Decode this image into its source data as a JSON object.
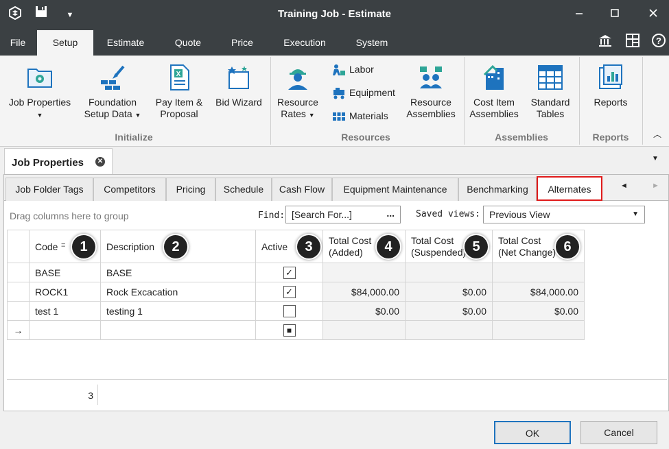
{
  "window": {
    "title": "Training Job - Estimate"
  },
  "menu": [
    "File",
    "Setup",
    "Estimate",
    "Quote",
    "Price",
    "Execution",
    "System"
  ],
  "ribbon": {
    "initialize": {
      "label": "Initialize",
      "job_properties": "Job Properties",
      "foundation_1": "Foundation",
      "foundation_2": "Setup Data",
      "pay_item_1": "Pay Item &",
      "pay_item_2": "Proposal",
      "bid_wizard": "Bid Wizard"
    },
    "resources": {
      "label": "Resources",
      "rates_1": "Resource",
      "rates_2": "Rates",
      "labor": "Labor",
      "equipment": "Equipment",
      "materials": "Materials",
      "assemblies_1": "Resource",
      "assemblies_2": "Assemblies"
    },
    "assemblies": {
      "label": "Assemblies",
      "cost_item_1": "Cost Item",
      "cost_item_2": "Assemblies",
      "standard_1": "Standard",
      "standard_2": "Tables"
    },
    "reports": {
      "label": "Reports",
      "reports": "Reports"
    }
  },
  "doc_tab": "Job Properties",
  "sub_tabs": [
    "Job Folder Tags",
    "Competitors",
    "Pricing",
    "Schedule",
    "Cash Flow",
    "Equipment Maintenance",
    "Benchmarking",
    "Alternates"
  ],
  "toolbar": {
    "group_hint": "Drag columns here to group",
    "find_label": "Find:",
    "find_placeholder": "[Search For...]",
    "find_more": "...",
    "saved_views_label": "Saved views:",
    "saved_view_value": "Previous View"
  },
  "columns": {
    "code": "Code",
    "description": "Description",
    "active": "Active",
    "added_1": "Total Cost",
    "added_2": "(Added)",
    "suspended_1": "Total Cost",
    "suspended_2": "(Suspended)",
    "net_1": "Total Cost",
    "net_2": "(Net Change)"
  },
  "callouts": [
    "1",
    "2",
    "3",
    "4",
    "5",
    "6"
  ],
  "rows": [
    {
      "code": "BASE",
      "description": "BASE",
      "active": true,
      "added": "",
      "suspended": "",
      "net": ""
    },
    {
      "code": "ROCK1",
      "description": "Rock Excacation",
      "active": true,
      "added": "$84,000.00",
      "suspended": "$0.00",
      "net": "$84,000.00"
    },
    {
      "code": "test 1",
      "description": "testing 1",
      "active": false,
      "added": "$0.00",
      "suspended": "$0.00",
      "net": "$0.00"
    }
  ],
  "new_row_marker": "→",
  "row_count": "3",
  "buttons": {
    "ok": "OK",
    "cancel": "Cancel"
  },
  "colors": {
    "titlebar": "#3b4043",
    "accent_blue": "#1e73be",
    "highlight_red": "#e01a1a",
    "icon_teal": "#2ea597"
  }
}
